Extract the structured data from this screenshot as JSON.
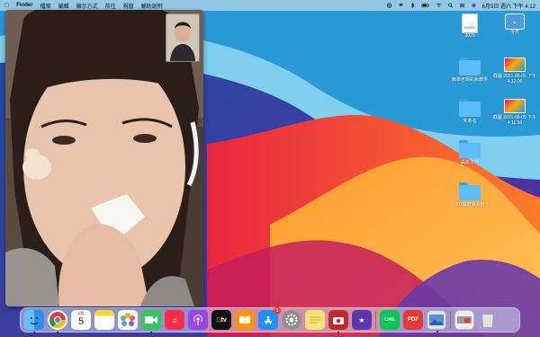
{
  "menubar": {
    "app_name": "Finder",
    "menus": [
      "檔案",
      "編輯",
      "顯示方式",
      "前往",
      "視窗",
      "輔助說明"
    ],
    "clock": "6月5日 週六 下午 4:12"
  },
  "desktop_items": [
    {
      "kind": "doc",
      "label": "2020",
      "doc_text": "DOCX"
    },
    {
      "kind": "drawer",
      "label": "今天"
    },
    {
      "kind": "folder",
      "label": "簡單老師彩妝教學"
    },
    {
      "kind": "shot",
      "label": "截圖 2021-06-05 下午 4.12.06"
    },
    {
      "kind": "folder",
      "label": "未命名"
    },
    {
      "kind": "shot",
      "label": "截圖 2021-06-05 下午 4.11.56"
    },
    {
      "kind": "folder",
      "label": "攝影工作"
    },
    {
      "kind": "folder",
      "label": "001攝影課素材"
    }
  ],
  "dock": {
    "calendar_month": "6月",
    "calendar_day": "5",
    "app_store_badge": "1",
    "line_label": "LINE",
    "pdf_label": "PDF",
    "apple_tv_label": "tv"
  }
}
